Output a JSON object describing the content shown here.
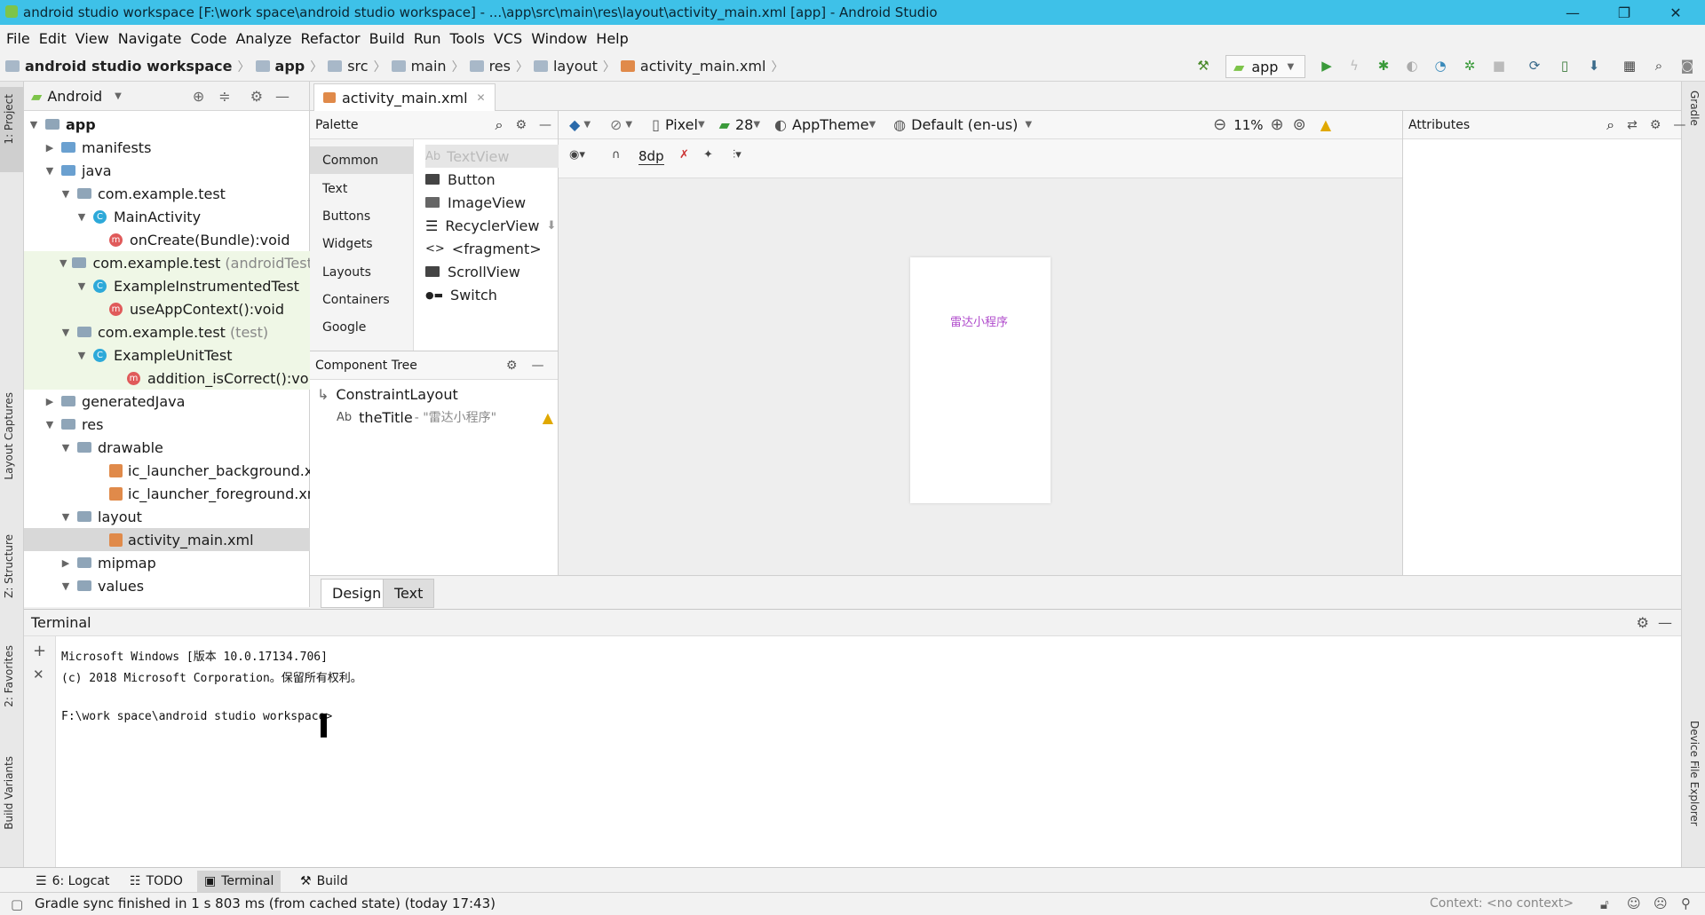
{
  "window": {
    "title": "android studio workspace [F:\\work space\\android studio workspace] - ...\\app\\src\\main\\res\\layout\\activity_main.xml [app] - Android Studio",
    "minimize": "—",
    "maximize": "❐",
    "close": "✕"
  },
  "menu": [
    "File",
    "Edit",
    "View",
    "Navigate",
    "Code",
    "Analyze",
    "Refactor",
    "Build",
    "Run",
    "Tools",
    "VCS",
    "Window",
    "Help"
  ],
  "breadcrumbs": [
    "android studio workspace",
    "app",
    "src",
    "main",
    "res",
    "layout",
    "activity_main.xml"
  ],
  "run_config": "app",
  "left_strip": {
    "project": "1: Project",
    "captures": "Layout Captures",
    "structure": "Z: Structure",
    "favorites": "2: Favorites",
    "variants": "Build Variants"
  },
  "right_strip": {
    "gradle": "Gradle",
    "device": "Device File Explorer"
  },
  "project": {
    "view": "Android",
    "tree": [
      {
        "label": "app",
        "bold": true
      },
      {
        "label": "manifests"
      },
      {
        "label": "java"
      },
      {
        "label": "com.example.test"
      },
      {
        "label": "MainActivity"
      },
      {
        "label": "onCreate(Bundle):void"
      },
      {
        "label": "com.example.test",
        "suffix": "(androidTest)"
      },
      {
        "label": "ExampleInstrumentedTest"
      },
      {
        "label": "useAppContext():void"
      },
      {
        "label": "com.example.test",
        "suffix": "(test)"
      },
      {
        "label": "ExampleUnitTest"
      },
      {
        "label": "addition_isCorrect():vo"
      },
      {
        "label": "generatedJava"
      },
      {
        "label": "res"
      },
      {
        "label": "drawable"
      },
      {
        "label": "ic_launcher_background.xml"
      },
      {
        "label": "ic_launcher_foreground.xml"
      },
      {
        "label": "layout"
      },
      {
        "label": "activity_main.xml"
      },
      {
        "label": "mipmap"
      },
      {
        "label": "values"
      }
    ]
  },
  "editor_tab": "activity_main.xml",
  "palette": {
    "title": "Palette",
    "categories": [
      "Common",
      "Text",
      "Buttons",
      "Widgets",
      "Layouts",
      "Containers",
      "Google"
    ],
    "items": [
      "TextView",
      "Button",
      "ImageView",
      "RecyclerView",
      "<fragment>",
      "ScrollView",
      "Switch"
    ]
  },
  "component_tree": {
    "title": "Component Tree",
    "root": "ConstraintLayout",
    "child_name": "theTitle",
    "child_value": "- \"雷达小程序\""
  },
  "design_toolbar": {
    "device": "Pixel",
    "api": "28",
    "theme": "AppTheme",
    "locale": "Default (en-us)",
    "zoom": "11%",
    "margin": "8dp"
  },
  "preview_text": "雷达小程序",
  "attributes_title": "Attributes",
  "design_tabs": [
    "Design",
    "Text"
  ],
  "terminal": {
    "title": "Terminal",
    "lines": [
      "Microsoft Windows [版本 10.0.17134.706]",
      "(c) 2018 Microsoft Corporation。保留所有权利。",
      "",
      "F:\\work space\\android studio workspace>"
    ]
  },
  "bottom_tabs": [
    "6: Logcat",
    "TODO",
    "Terminal",
    "Build"
  ],
  "status": {
    "message": "Gradle sync finished in 1 s 803 ms (from cached state) (today 17:43)",
    "context": "Context: <no context>"
  },
  "colors": {
    "titlebar": "#3ec1e8",
    "preview_text": "#b04ccc",
    "tree_highlight": "#eff7e6"
  }
}
